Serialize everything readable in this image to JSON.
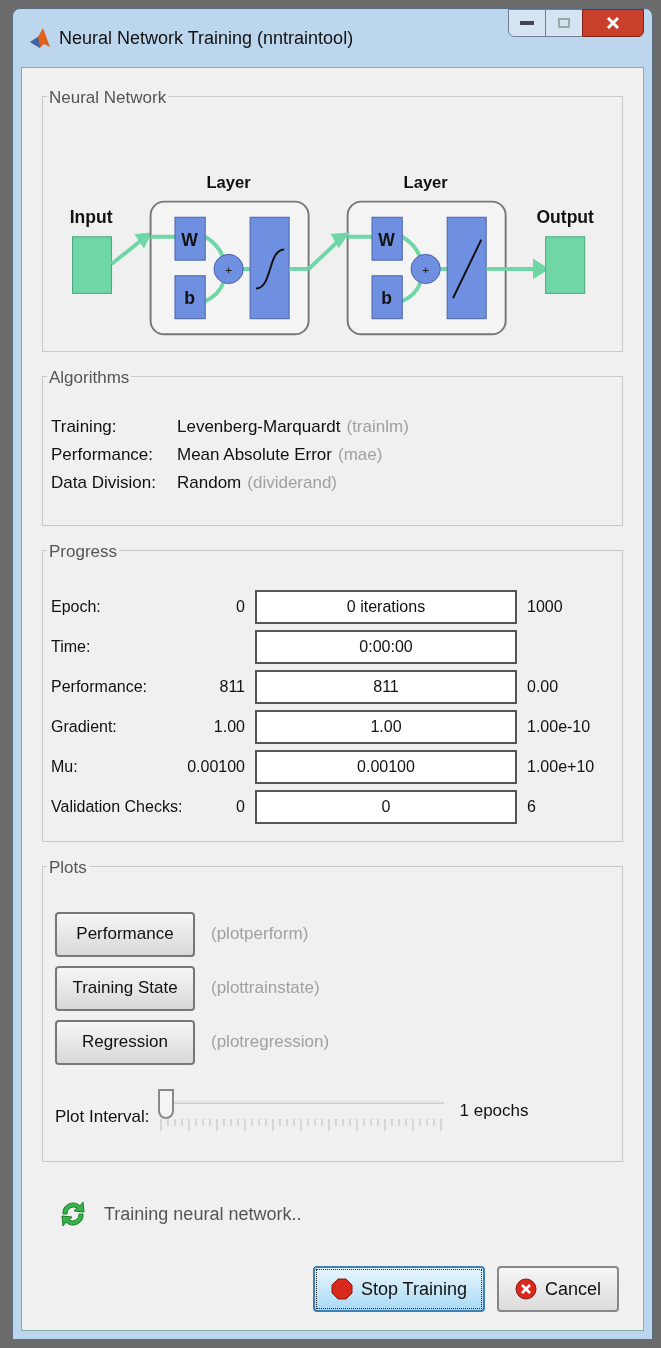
{
  "window": {
    "title": "Neural Network Training (nntraintool)"
  },
  "network": {
    "title": "Neural Network",
    "input_label": "Input",
    "output_label": "Output",
    "layers": [
      {
        "label": "Layer",
        "weight": "W",
        "bias": "b",
        "sum": "+",
        "kind": "sigmoid"
      },
      {
        "label": "Layer",
        "weight": "W",
        "bias": "b",
        "sum": "+",
        "kind": "linear"
      }
    ]
  },
  "algorithms": {
    "title": "Algorithms",
    "rows": [
      {
        "label": "Training:",
        "value": "Levenberg-Marquardt",
        "function": "(trainlm)"
      },
      {
        "label": "Performance:",
        "value": "Mean Absolute Error",
        "function": "(mae)"
      },
      {
        "label": "Data Division:",
        "value": "Random",
        "function": "(dividerand)"
      }
    ]
  },
  "progress": {
    "title": "Progress",
    "rows": [
      {
        "label": "Epoch:",
        "start": "0",
        "current": "0 iterations",
        "target": "1000"
      },
      {
        "label": "Time:",
        "current": "0:00:00"
      },
      {
        "label": "Performance:",
        "start": "811",
        "current": "811",
        "target": "0.00"
      },
      {
        "label": "Gradient:",
        "start": "1.00",
        "current": "1.00",
        "target": "1.00e-10"
      },
      {
        "label": "Mu:",
        "start": "0.00100",
        "current": "0.00100",
        "target": "1.00e+10"
      },
      {
        "label": "Validation Checks:",
        "start": "0",
        "current": "0",
        "target": "6"
      }
    ]
  },
  "plots": {
    "title": "Plots",
    "buttons": [
      {
        "label": "Performance",
        "function": "(plotperform)"
      },
      {
        "label": "Training State",
        "function": "(plottrainstate)"
      },
      {
        "label": "Regression",
        "function": "(plotregression)"
      }
    ],
    "interval": {
      "label": "Plot Interval:",
      "level": 0,
      "reading": "1 epochs"
    }
  },
  "status": "Training neural network..",
  "buttons": [
    {
      "label": "Stop Training",
      "kind": "stop",
      "focused": true
    },
    {
      "label": "Cancel",
      "kind": "cancel",
      "focused": false
    }
  ]
}
